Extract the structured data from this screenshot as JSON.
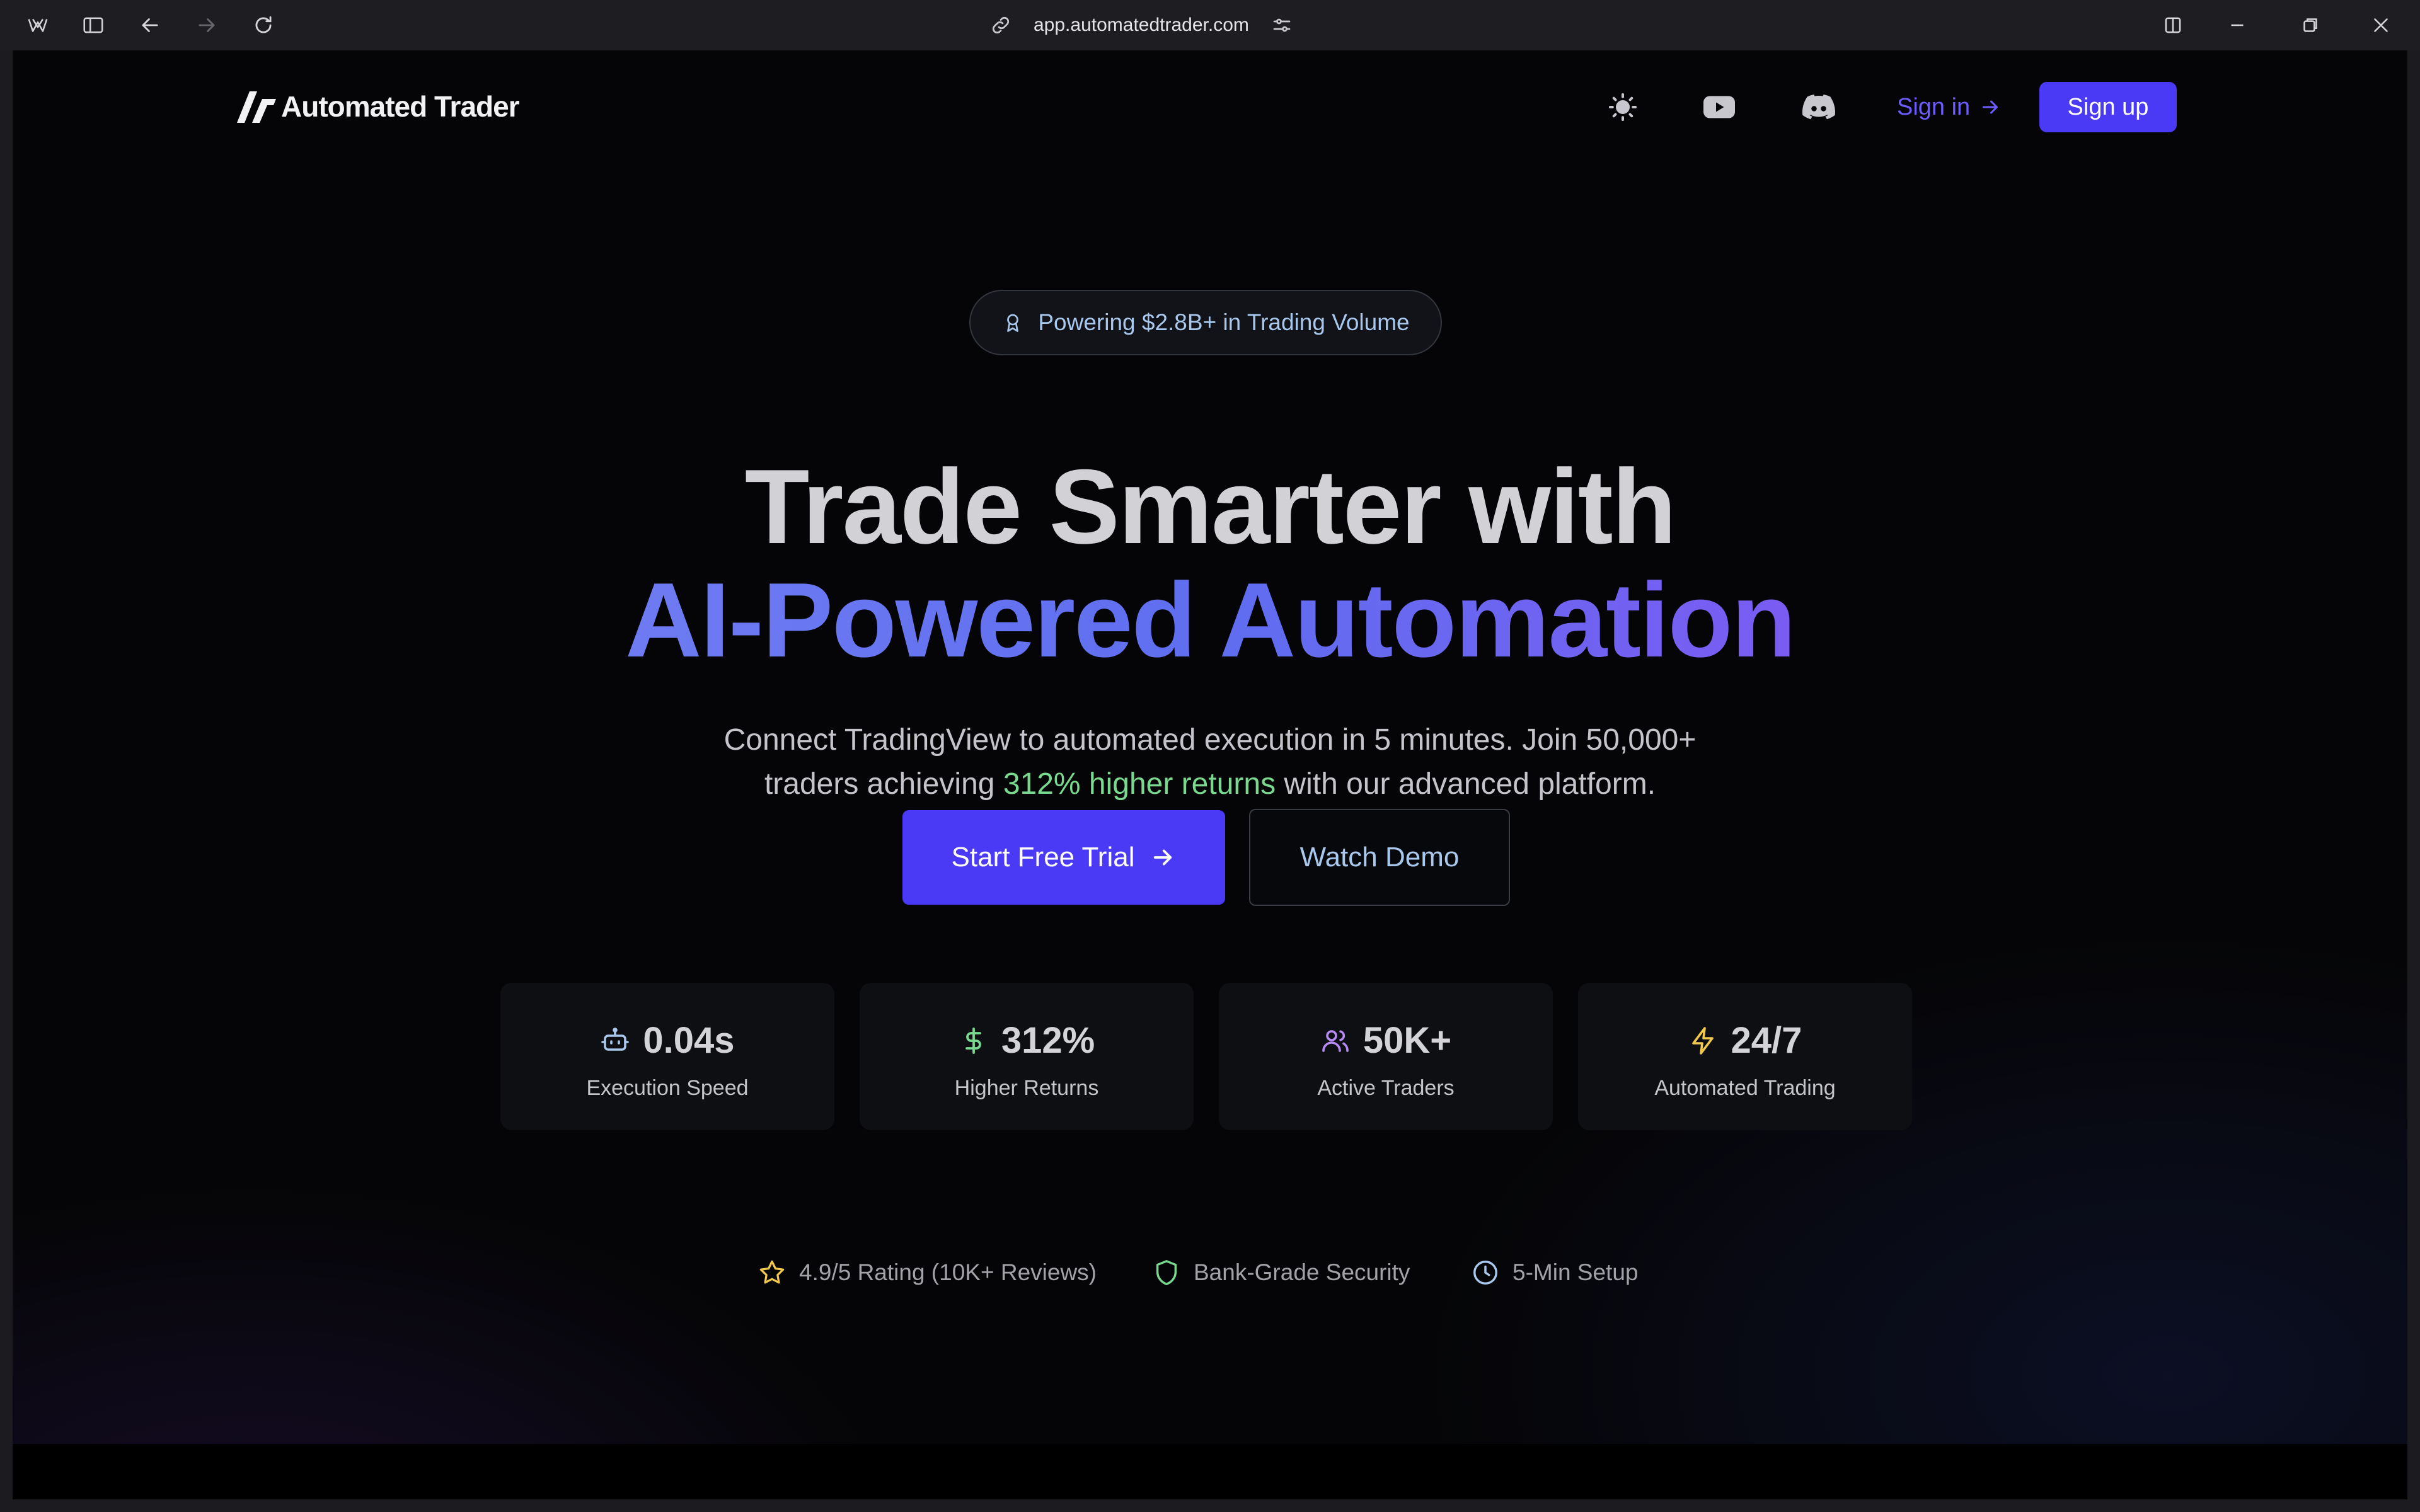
{
  "browser": {
    "url": "app.automatedtrader.com"
  },
  "nav": {
    "logo_text": "Automated Trader",
    "signin_label": "Sign in",
    "signup_label": "Sign up"
  },
  "hero": {
    "pill_text": "Powering $2.8B+ in Trading Volume",
    "title_line1": "Trade Smarter with",
    "title_line2": "AI-Powered Automation",
    "subtitle_line1": "Connect TradingView to automated execution in 5 minutes. Join 50,000+",
    "subtitle_line2_pre": "traders achieving ",
    "subtitle_highlight": "312% higher returns",
    "subtitle_line2_post": " with our advanced platform.",
    "primary_cta": "Start Free Trial",
    "secondary_cta": "Watch Demo"
  },
  "stats": [
    {
      "icon": "robot-icon",
      "value": "0.04s",
      "label": "Execution Speed",
      "color": "#a9c8ee"
    },
    {
      "icon": "dollar-icon",
      "value": "312%",
      "label": "Higher Returns",
      "color": "#78d98f"
    },
    {
      "icon": "users-icon",
      "value": "50K+",
      "label": "Active Traders",
      "color": "#b58cf5"
    },
    {
      "icon": "lightning-icon",
      "value": "24/7",
      "label": "Automated Trading",
      "color": "#f2c94c"
    }
  ],
  "trust": [
    {
      "icon": "star-icon",
      "text": "4.9/5 Rating (10K+ Reviews)",
      "color": "#f2c94c"
    },
    {
      "icon": "shield-icon",
      "text": "Bank-Grade Security",
      "color": "#78d98f"
    },
    {
      "icon": "clock-icon",
      "text": "5-Min Setup",
      "color": "#a9c8ee"
    }
  ],
  "colors": {
    "accent": "#4a3af5",
    "link": "#6d5cff",
    "highlight_green": "#78d98f",
    "gradient_text": "#6e7bf2"
  }
}
